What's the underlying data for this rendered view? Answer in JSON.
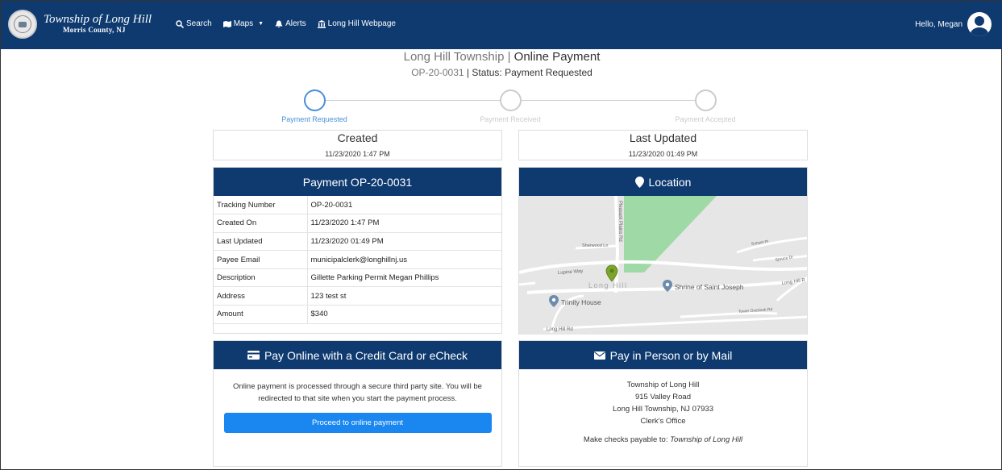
{
  "nav": {
    "brand_name": "Township of Long Hill",
    "brand_sub": "Morris County, NJ",
    "links": [
      {
        "label": "Search",
        "icon": "search-icon"
      },
      {
        "label": "Maps",
        "icon": "map-icon"
      },
      {
        "label": "Alerts",
        "icon": "bell-icon"
      },
      {
        "label": "Long Hill Webpage",
        "icon": "institution-icon"
      }
    ],
    "greeting": "Hello, Megan"
  },
  "header": {
    "title_prefix": "Long Hill Township",
    "title_sep": " | ",
    "title_main": "Online Payment",
    "record_id": "OP-20-0031",
    "status_sep": " | ",
    "status": "Status: Payment Requested"
  },
  "stepper": {
    "steps": [
      {
        "label": "Payment Requested",
        "active": true
      },
      {
        "label": "Payment Received",
        "active": false
      },
      {
        "label": "Payment Accepted",
        "active": false
      }
    ]
  },
  "created": {
    "title": "Created",
    "value": "11/23/2020 1:47 PM"
  },
  "updated": {
    "title": "Last Updated",
    "value": "11/23/2020 01:49 PM"
  },
  "payment": {
    "title": "Payment OP-20-0031",
    "rows": [
      {
        "label": "Tracking Number",
        "value": "OP-20-0031"
      },
      {
        "label": "Created On",
        "value": "11/23/2020 1:47 PM"
      },
      {
        "label": "Last Updated",
        "value": "11/23/2020 01:49 PM"
      },
      {
        "label": "Payee Email",
        "value": "municipalclerk@longhillnj.us"
      },
      {
        "label": "Description",
        "value": "Gillette Parking Permit Megan Phillips"
      },
      {
        "label": "Address",
        "value": "123 test st"
      },
      {
        "label": "Amount",
        "value": "$340"
      }
    ]
  },
  "location": {
    "title": "Location",
    "map_labels": {
      "road_1": "Lupine Way",
      "road_2": "Sherwood Ln",
      "road_3": "Long Hill Rd",
      "road_4": "Long Hill R",
      "road_5": "Pleasant Plains Rd",
      "area": "Long Hill",
      "poi_1": "Trinity House",
      "poi_2": "Shrine of Saint Joseph",
      "road_6": "Tower Overlook Rd",
      "road_7": "Spruce Dr",
      "road_8": "Sunset Pl"
    }
  },
  "online": {
    "title": "Pay Online with a Credit Card or eCheck",
    "line1": "Online payment is processed through a secure third party site. You will be",
    "line2": "redirected to that site when you start the payment process.",
    "button": "Proceed to online payment"
  },
  "mail": {
    "title": "Pay in Person or by Mail",
    "address": [
      "Township of Long Hill",
      "915 Valley Road",
      "Long Hill Township, NJ 07933",
      "Clerk's Office"
    ],
    "note_prefix": "Make checks payable to: ",
    "note_payee": "Township of Long Hill"
  },
  "colors": {
    "primary": "#0e3a70",
    "accent": "#4a90d9",
    "button": "#1a86f0"
  }
}
